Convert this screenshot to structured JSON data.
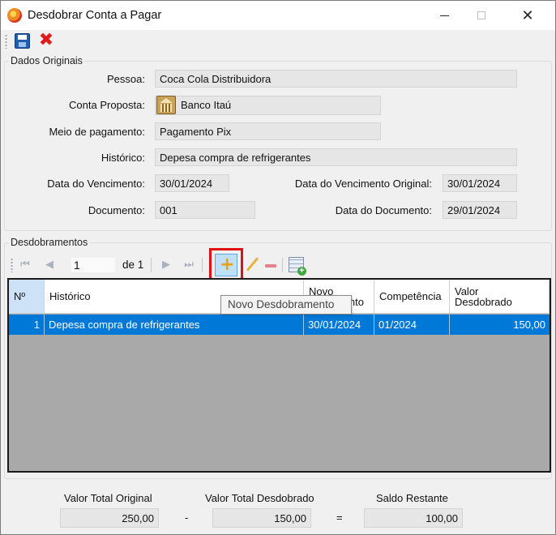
{
  "window": {
    "title": "Desdobrar Conta a Pagar",
    "minimize_glyph": "",
    "close_glyph": "✕"
  },
  "toolbar": {
    "save_icon": "save-icon",
    "close_icon": "close-x-icon",
    "close_glyph": "✖"
  },
  "dados_originais": {
    "title": "Dados Originais",
    "pessoa_label": "Pessoa:",
    "pessoa_value": "Coca Cola Distribuidora",
    "conta_label": "Conta Proposta:",
    "conta_value": "Banco Itaú",
    "meio_label": "Meio de pagamento:",
    "meio_value": "Pagamento Pix",
    "historico_label": "Histórico:",
    "historico_value": "Depesa compra de refrigerantes",
    "vencimento_label": "Data do Vencimento:",
    "vencimento_value": "30/01/2024",
    "venc_original_label": "Data do Vencimento Original:",
    "venc_original_value": "30/01/2024",
    "documento_label": "Documento:",
    "documento_value": "001",
    "data_documento_label": "Data do Documento:",
    "data_documento_value": "29/01/2024"
  },
  "desdobramentos": {
    "title": "Desdobramentos",
    "navigator": {
      "first_glyph": "⏮",
      "prev_glyph": "◀",
      "position": "1",
      "of_label": "de 1",
      "next_glyph": "▶",
      "last_glyph": "⏭",
      "add_glyph": "+",
      "add_tooltip": "Novo Desdobramento"
    },
    "columns": [
      "Nº",
      "Histórico",
      "Novo\nVencimento",
      "Competência",
      "Valor\nDesdobrado"
    ],
    "rows": [
      {
        "n": "1",
        "historico": "Depesa compra de refrigerantes",
        "novo_vencimento": "30/01/2024",
        "competencia": "01/2024",
        "valor": "150,00"
      }
    ]
  },
  "totals": {
    "original_label": "Valor Total Original",
    "original_value": "250,00",
    "minus": "-",
    "desdobrado_label": "Valor Total Desdobrado",
    "desdobrado_value": "150,00",
    "equals": "=",
    "saldo_label": "Saldo Restante",
    "saldo_value": "100,00"
  },
  "colors": {
    "selection": "#0078d7",
    "grid_background": "#a9a9a9",
    "highlight_border": "#e01010"
  }
}
